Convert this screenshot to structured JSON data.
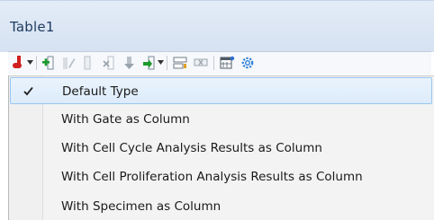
{
  "window": {
    "title": "Table1"
  },
  "toolbar": {
    "icons": [
      "table-type-icon",
      "add-row-icon",
      "edit-icon",
      "column-icon",
      "delete-icon",
      "move-down-icon",
      "insert-column-icon",
      "filter-icon",
      "clear-filter-icon",
      "table-settings-icon",
      "gear-icon"
    ]
  },
  "menu": {
    "items": [
      {
        "label": "Default Type",
        "checked": true
      },
      {
        "label": "With Gate as Column",
        "checked": false
      },
      {
        "label": "With Cell Cycle Analysis Results as Column",
        "checked": false
      },
      {
        "label": "With Cell Proliferation Analysis Results as Column",
        "checked": false
      },
      {
        "label": "With Specimen as Column",
        "checked": false
      }
    ]
  },
  "colors": {
    "accent_red": "#d11f1f",
    "accent_green": "#1c9a2b",
    "selection_border": "#99c6f0"
  }
}
